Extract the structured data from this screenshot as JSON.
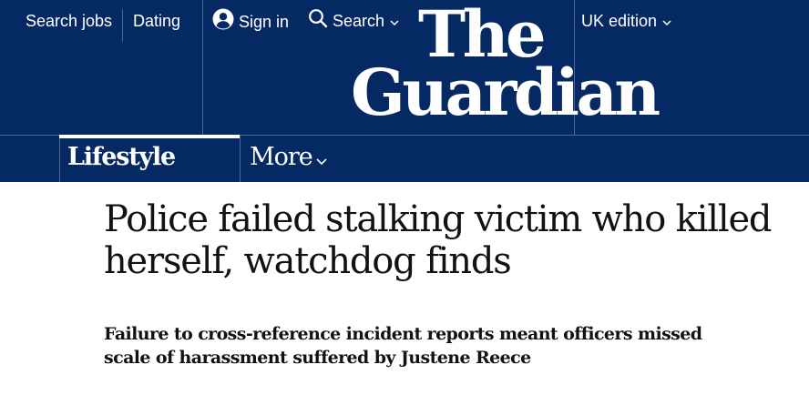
{
  "header": {
    "links": {
      "search_jobs": "Search jobs",
      "dating": "Dating",
      "sign_in": "Sign in",
      "search": "Search",
      "edition": "UK edition"
    },
    "logo_line1": "The",
    "logo_line2": "Guardian"
  },
  "nav": {
    "pillar": "Lifestyle",
    "more": "More"
  },
  "article": {
    "headline": "Police failed stalking victim who killed herself, watchdog finds",
    "standfirst": "Failure to cross-reference incident reports meant officers missed scale of harassment suffered by Justene Reece"
  },
  "colors": {
    "brand_blue": "#052962",
    "divider": "#506991",
    "text": "#121212",
    "white": "#ffffff"
  },
  "icons": {
    "sign_in": "user-circle-icon",
    "search": "search-icon",
    "dropdown": "chevron-down-icon"
  }
}
